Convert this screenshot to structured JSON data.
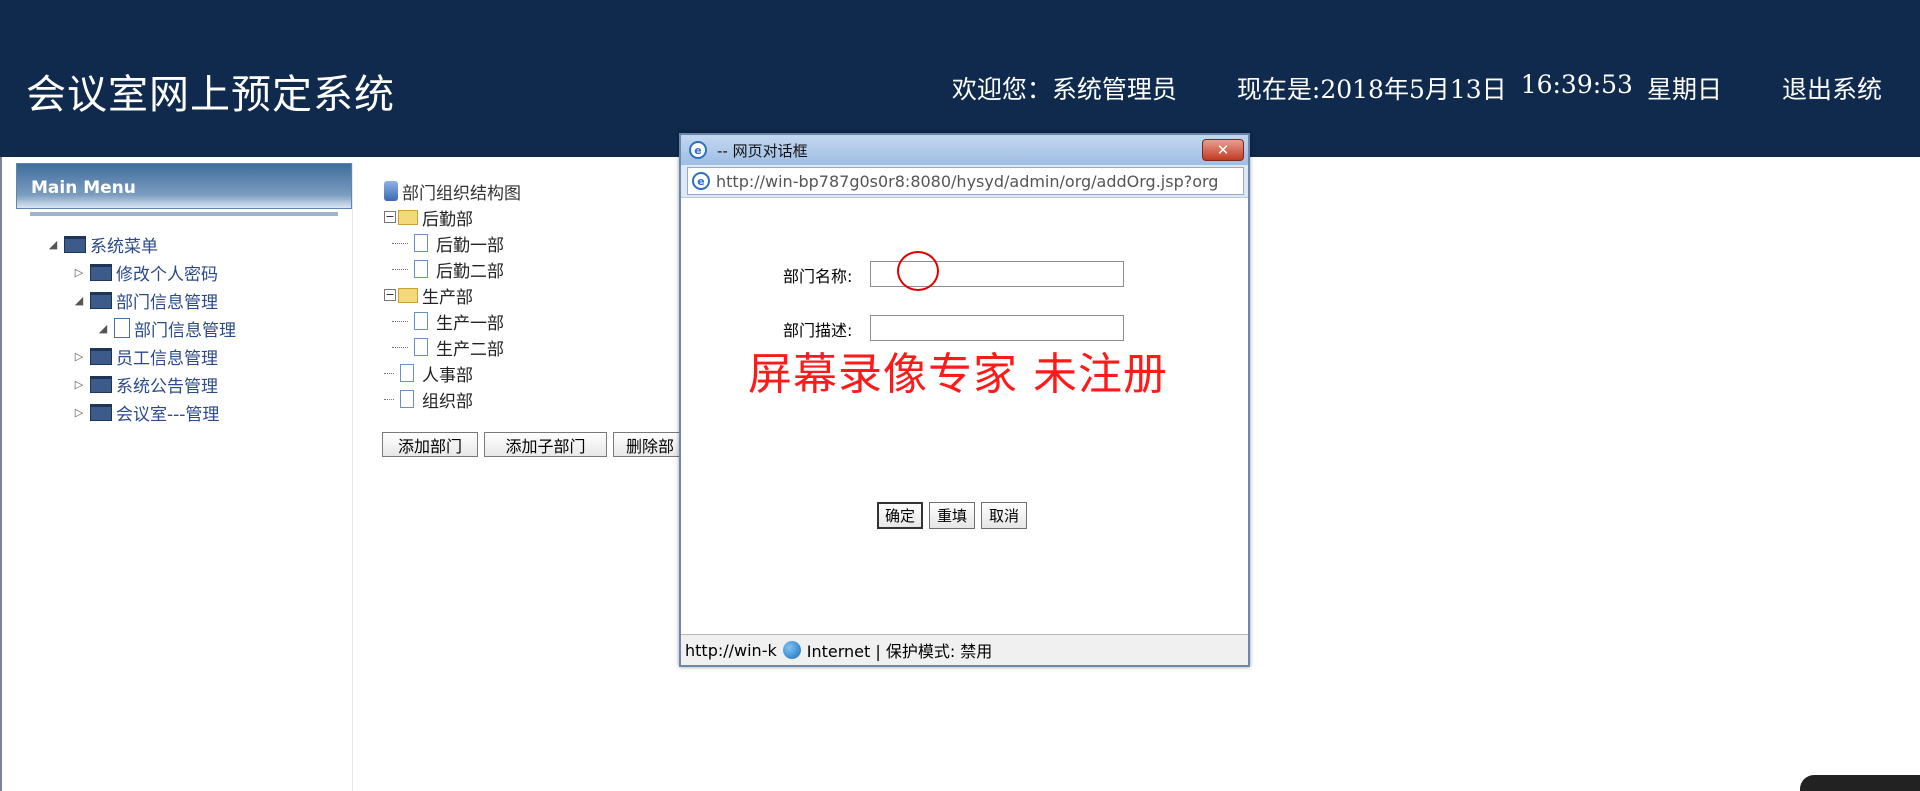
{
  "header": {
    "title": "会议室网上预定系统",
    "welcome": "欢迎您：系统管理员",
    "datetime_prefix": "现在是:2018年5月13日",
    "time": "16:39:53",
    "weekday": "星期日",
    "logout": "退出系统"
  },
  "sidebar": {
    "header": "Main Menu",
    "items": [
      {
        "label": "系统菜单"
      },
      {
        "label": "修改个人密码"
      },
      {
        "label": "部门信息管理"
      },
      {
        "label": "部门信息管理"
      },
      {
        "label": "员工信息管理"
      },
      {
        "label": "系统公告管理"
      },
      {
        "label": "会议室---管理"
      }
    ]
  },
  "dept_tree": {
    "root": "部门组织结构图",
    "nodes": [
      {
        "label": "后勤部"
      },
      {
        "label": "后勤一部"
      },
      {
        "label": "后勤二部"
      },
      {
        "label": "生产部"
      },
      {
        "label": "生产一部"
      },
      {
        "label": "生产二部"
      },
      {
        "label": "人事部"
      },
      {
        "label": "组织部"
      }
    ],
    "buttons": {
      "add": "添加部门",
      "add_child": "添加子部门",
      "delete": "删除部"
    }
  },
  "dialog": {
    "title": "-- 网页对话框",
    "url": "http://win-bp787g0s0r8:8080/hysyd/admin/org/addOrg.jsp?org",
    "name_label": "部门名称:",
    "name_value": "",
    "desc_label": "部门描述:",
    "desc_value": "",
    "buttons": {
      "ok": "确定",
      "reset": "重填",
      "cancel": "取消"
    },
    "status": "http://win-k",
    "status_zone": "Internet | 保护模式: 禁用"
  },
  "watermark": "屏幕录像专家  未注册",
  "colors": {
    "header_bg": "#0f2a4d",
    "watermark": "#ff1a1a"
  }
}
